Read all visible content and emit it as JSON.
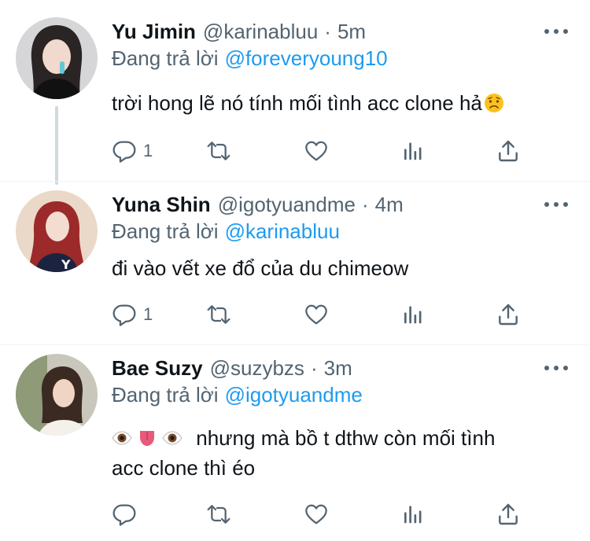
{
  "tweets": [
    {
      "name": "Yu Jimin",
      "handle": "@karinabluu",
      "separator": "·",
      "time": "5m",
      "reply_prefix": "Đang trả lời",
      "reply_to": "@foreveryoung10",
      "text": "trời hong lẽ nó tính mối tình acc clone hả",
      "trailing_emoji": "worried-face",
      "reply_count": "1"
    },
    {
      "name": "Yuna Shin",
      "handle": "@igotyuandme",
      "separator": "·",
      "time": "4m",
      "reply_prefix": "Đang trả lời",
      "reply_to": "@karinabluu",
      "text": "đi vào vết xe đổ của du chimeow",
      "reply_count": "1"
    },
    {
      "name": "Bae Suzy",
      "handle": "@suzybzs",
      "separator": "·",
      "time": "3m",
      "reply_prefix": "Đang trả lời",
      "reply_to": "@igotyuandme",
      "leading_emojis": [
        "eye",
        "tongue",
        "eye"
      ],
      "text_line1": "nhưng mà bồ t dthw còn mối tình",
      "text_line2": "acc clone thì éo",
      "reply_count": ""
    }
  ],
  "icons": [
    "reply-icon",
    "retweet-icon",
    "like-icon",
    "analytics-icon",
    "share-icon",
    "more-icon"
  ],
  "colors": {
    "link": "#1d9bf0",
    "secondary": "#536471",
    "text": "#0f1419",
    "thread_line": "#cfd9de"
  }
}
